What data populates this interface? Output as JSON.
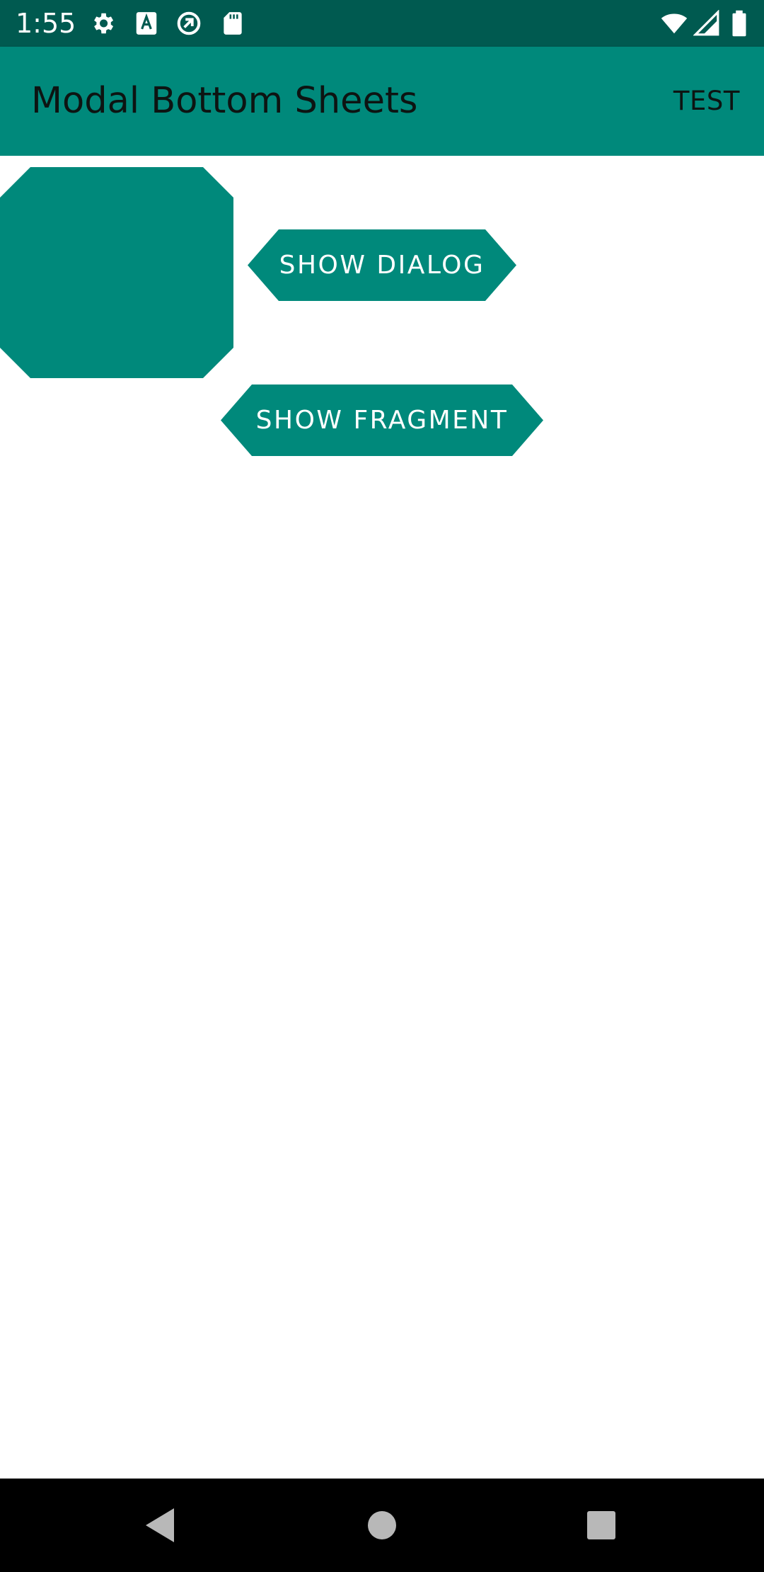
{
  "status_bar": {
    "time": "1:55",
    "background_color": "#005a50",
    "left_icons": [
      "settings-icon",
      "text-a-icon",
      "sync-icon",
      "sd-card-icon"
    ],
    "right_icons": [
      "wifi-icon",
      "cell-signal-icon",
      "battery-icon"
    ]
  },
  "app_bar": {
    "title": "Modal Bottom Sheets",
    "action_label": "TEST",
    "background_color": "#00897b"
  },
  "content": {
    "shape_color": "#00897b",
    "show_dialog_label": "SHOW DIALOG",
    "show_fragment_label": "SHOW FRAGMENT"
  },
  "nav_bar": {
    "buttons": [
      "back-icon",
      "home-icon",
      "recents-icon"
    ],
    "background_color": "#000000"
  }
}
